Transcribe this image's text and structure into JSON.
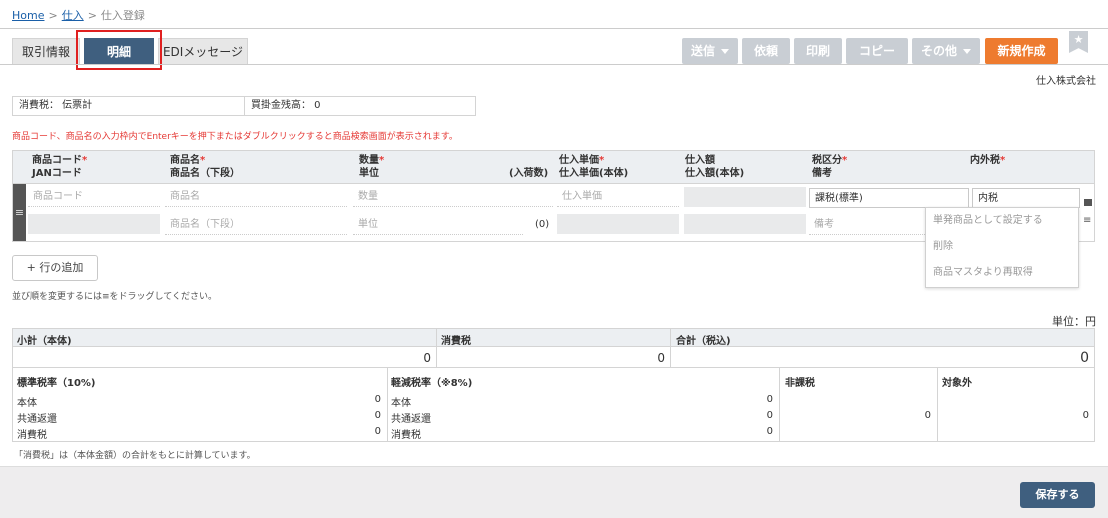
{
  "breadcrumb": {
    "home": "Home",
    "purchase": "仕入",
    "current": "仕入登録",
    "sep": ">"
  },
  "tabs": [
    {
      "label": "取引情報"
    },
    {
      "label": "明細",
      "active": true
    },
    {
      "label": "EDIメッセージ"
    }
  ],
  "toolbar": {
    "send": "送信",
    "request": "依頼",
    "print": "印刷",
    "copy": "コピー",
    "other": "その他",
    "new": "新規作成",
    "bookmark_icon": "star-icon"
  },
  "company": "仕入株式会社",
  "summary": {
    "tax": "消費税： 伝票計",
    "balance": "買掛金残高： 0"
  },
  "notice": "商品コード、商品名の入力枠内でEnterキーを押下またはダブルクリックすると商品検索画面が表示されます。",
  "detail": {
    "headers": {
      "code": "商品コード",
      "jan": "JANコード",
      "name": "商品名",
      "name2": "商品名（下段）",
      "qty": "数量",
      "unit": "単位",
      "per_case": "(入荷数)",
      "price": "仕入単価",
      "price_net": "仕入単価(本体)",
      "amount": "仕入額",
      "amount_net": "仕入額(本体)",
      "tax_class": "税区分",
      "memo": "備考",
      "tax_incl": "内外税",
      "required_mark": "*"
    },
    "placeholders": {
      "code": "商品コード",
      "name": "商品名",
      "name2": "商品名（下段）",
      "qty": "数量",
      "unit": "単位",
      "price": "仕入単価",
      "memo": "備考"
    },
    "values": {
      "tax_class": "課税(標準)",
      "tax_incl": "内税",
      "per_case": "(0)"
    },
    "handle_icon": "≡"
  },
  "menu": {
    "items": [
      "単発商品として設定する",
      "削除",
      "商品マスタより再取得"
    ]
  },
  "add_row": "+ 行の追加",
  "drag_note": "並び順を変更するには≡をドラッグしてください。",
  "unit_label": "単位：円",
  "totals": {
    "subtotal_label": "小計（本体)",
    "subtotal": "0",
    "tax_label": "消費税",
    "tax": "0",
    "total_label": "合計（税込)",
    "total": "0",
    "standard_label": "標準税率（10%)",
    "reduced_label": "軽減税率（※8%)",
    "nontax_label": "非課税",
    "nontax": "0",
    "excluded_label": "対象外",
    "excluded": "0",
    "rows": [
      {
        "label": "本体",
        "standard": "0",
        "reduced": "0"
      },
      {
        "label": "共通返還",
        "standard": "0",
        "reduced": "0"
      },
      {
        "label": "消費税",
        "standard": "0",
        "reduced": "0"
      }
    ]
  },
  "footnote": "「消費税」は（本体金額）の合計をもとに計算しています。",
  "save": "保存する"
}
